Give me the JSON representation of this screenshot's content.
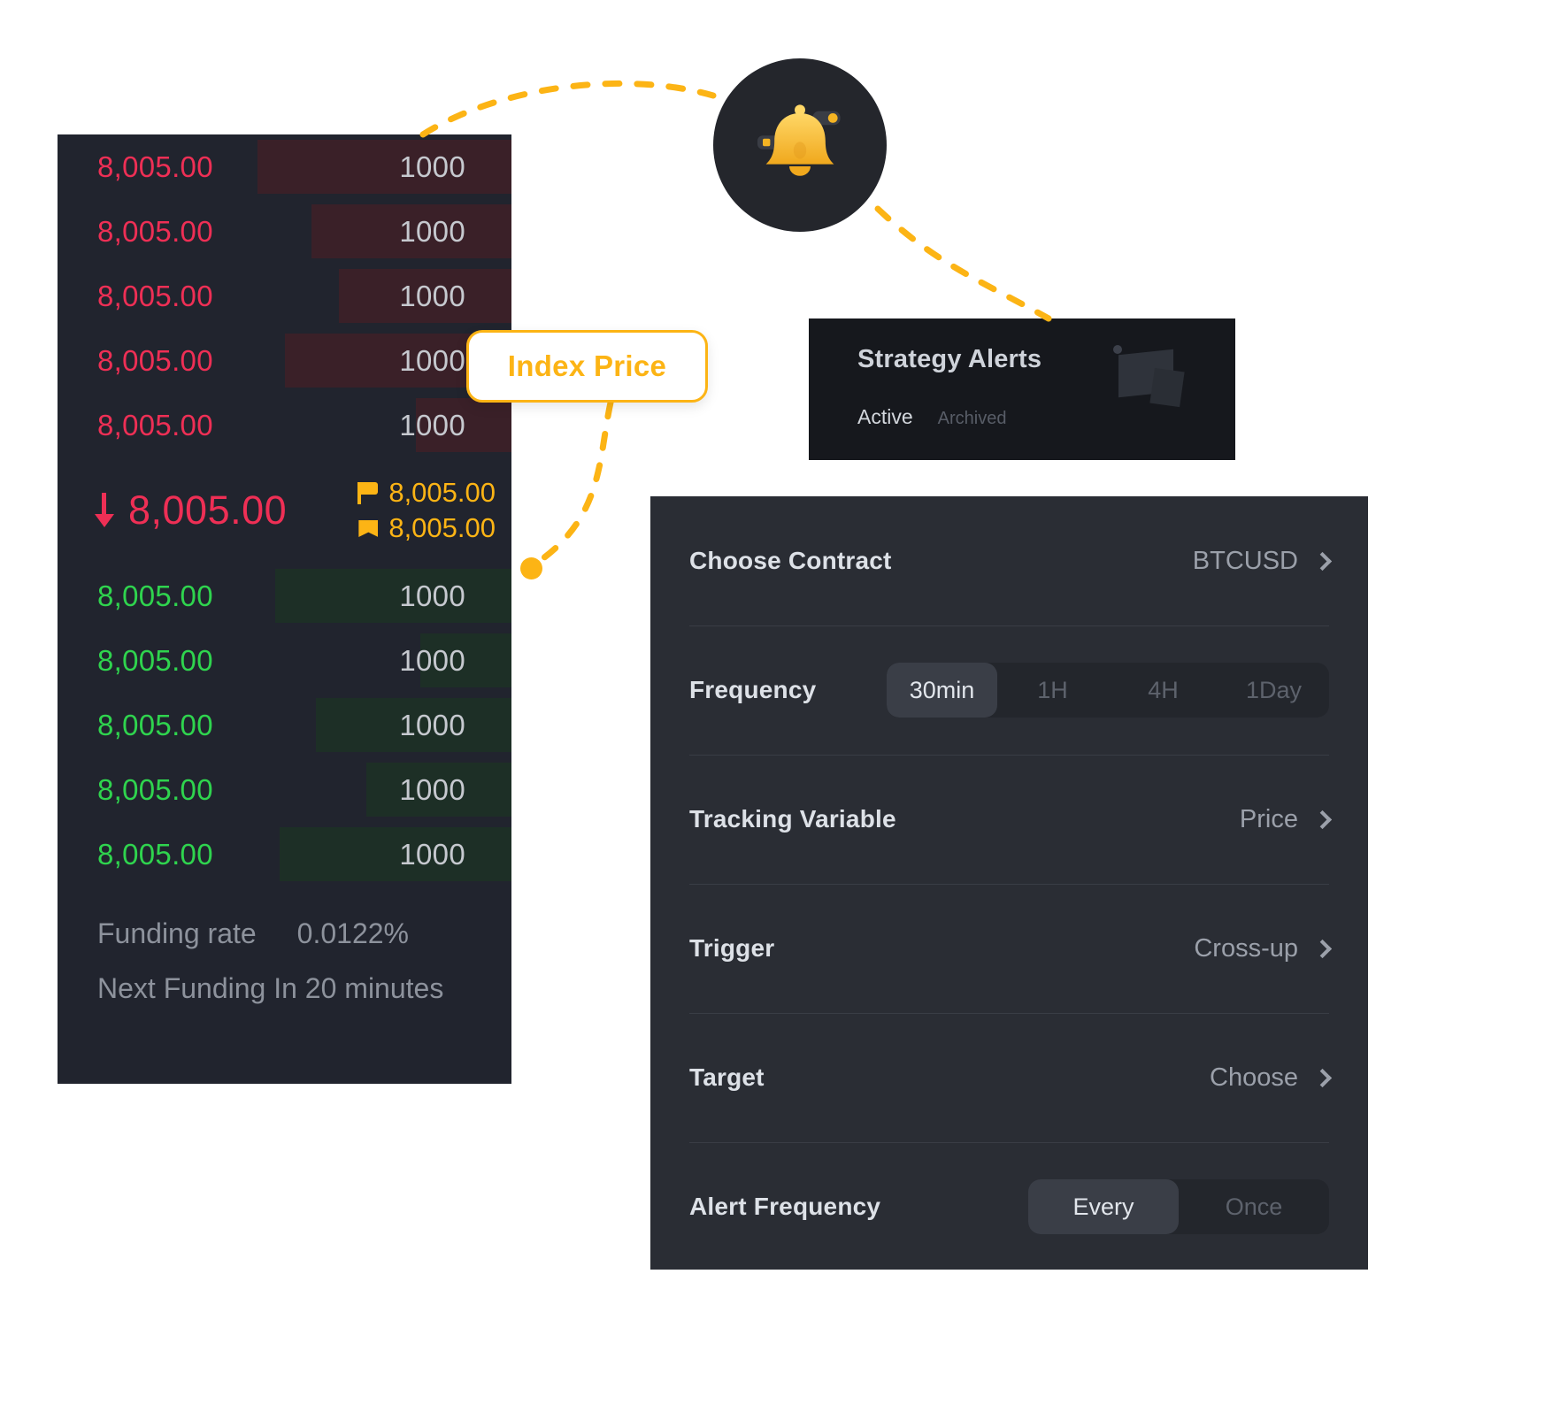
{
  "orderbook": {
    "asks": [
      {
        "price": "8,005.00",
        "size": "1000",
        "bar_pct": 56
      },
      {
        "price": "8,005.00",
        "size": "1000",
        "bar_pct": 44
      },
      {
        "price": "8,005.00",
        "size": "1000",
        "bar_pct": 38
      },
      {
        "price": "8,005.00",
        "size": "1000",
        "bar_pct": 50
      },
      {
        "price": "8,005.00",
        "size": "1000",
        "bar_pct": 21
      }
    ],
    "last": {
      "price": "8,005.00",
      "direction_icon": "arrow-down-icon",
      "index_price": "8,005.00",
      "index_icon": "flag-icon",
      "mark_price": "8,005.00",
      "mark_icon": "bookmark-icon"
    },
    "bids": [
      {
        "price": "8,005.00",
        "size": "1000",
        "bar_pct": 52
      },
      {
        "price": "8,005.00",
        "size": "1000",
        "bar_pct": 20
      },
      {
        "price": "8,005.00",
        "size": "1000",
        "bar_pct": 43
      },
      {
        "price": "8,005.00",
        "size": "1000",
        "bar_pct": 32
      },
      {
        "price": "8,005.00",
        "size": "1000",
        "bar_pct": 51
      }
    ],
    "footer": {
      "funding_label": "Funding rate",
      "funding_value": "0.0122%",
      "next_funding": "Next Funding In 20 minutes"
    },
    "colors": {
      "ask": "#ee2f55",
      "bid": "#2fd44e",
      "accent": "#fcb415",
      "panel_bg": "#21242e"
    }
  },
  "callout": {
    "label": "Index Price"
  },
  "bell": {
    "icon": "bell-notification-icon"
  },
  "alerts_card": {
    "title": "Strategy Alerts",
    "tabs": [
      {
        "label": "Active",
        "selected": true
      },
      {
        "label": "Archived",
        "selected": false
      }
    ]
  },
  "settings": {
    "rows": [
      {
        "label": "Choose Contract",
        "value": "BTCUSD",
        "type": "chevron"
      },
      {
        "label": "Frequency",
        "type": "segmented",
        "options": [
          "30min",
          "1H",
          "4H",
          "1Day"
        ],
        "selected": "30min"
      },
      {
        "label": "Tracking Variable",
        "value": "Price",
        "type": "chevron"
      },
      {
        "label": "Trigger",
        "value": "Cross-up",
        "type": "chevron"
      },
      {
        "label": "Target",
        "value": "Choose",
        "type": "chevron"
      },
      {
        "label": "Alert Frequency",
        "type": "toggle",
        "options": [
          "Every",
          "Once"
        ],
        "selected": "Every"
      }
    ]
  }
}
